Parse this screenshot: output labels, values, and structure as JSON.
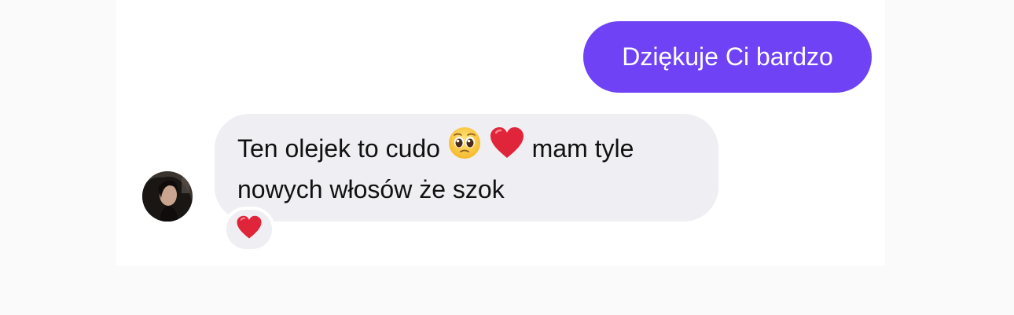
{
  "conversation": {
    "sent_message": {
      "text": "Dziękuje Ci bardzo"
    },
    "received_message": {
      "line1_start": "Ten olejek to cudo",
      "emoji_1": "pleading-face-icon",
      "emoji_2": "red-heart-icon",
      "line1_end": "mam tyle",
      "line2": "nowych włosów że szok",
      "reaction": "red-heart-icon"
    }
  },
  "colors": {
    "sent_bubble": "#6f42f5",
    "received_bubble": "#efeff3",
    "heart": "#e0243a",
    "background": "#fafafa"
  }
}
